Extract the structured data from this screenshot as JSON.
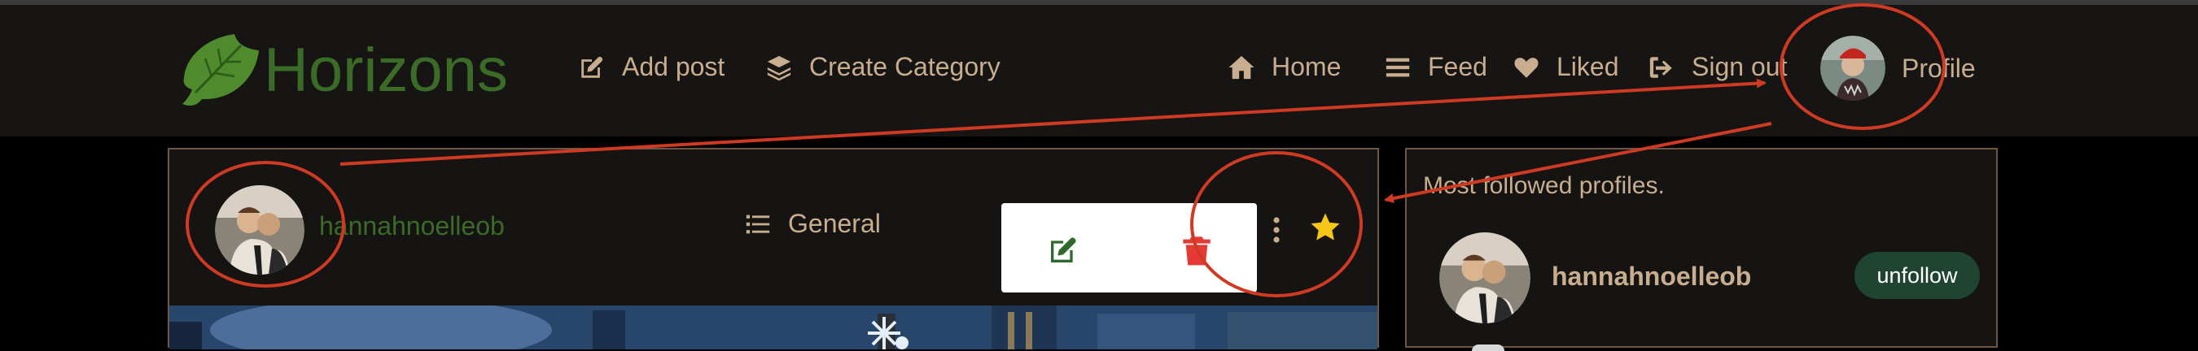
{
  "brand": {
    "name": "Horizons",
    "logo_icon": "leaf-logo-icon",
    "color": "#3a6b27"
  },
  "nav_left": [
    {
      "label": "Add post",
      "icon": "edit-icon"
    },
    {
      "label": "Create Category",
      "icon": "layers-icon"
    }
  ],
  "nav_right": [
    {
      "label": "Home",
      "icon": "home-icon"
    },
    {
      "label": "Feed",
      "icon": "menu-icon"
    },
    {
      "label": "Liked",
      "icon": "heart-icon"
    },
    {
      "label": "Sign out",
      "icon": "sign-out-icon"
    },
    {
      "label": "Profile",
      "icon": "avatar"
    }
  ],
  "post": {
    "username": "hannahnoelleob",
    "category": "General",
    "popup_actions": [
      "edit-icon",
      "trash-icon"
    ],
    "menu_icon": "more-vertical-icon",
    "favorite_icon": "star-icon"
  },
  "sidebar": {
    "title": "Most followed profiles.",
    "profiles": [
      {
        "username": "hannahnoelleob",
        "action": "unfollow"
      }
    ]
  },
  "colors": {
    "accent_tan": "#c8ae8f",
    "brand_green": "#3a6b27",
    "unfollow_bg": "#1f4432",
    "annotation_red": "#d03a22",
    "delete_red": "#e53935",
    "star_yellow": "#f5c518"
  }
}
